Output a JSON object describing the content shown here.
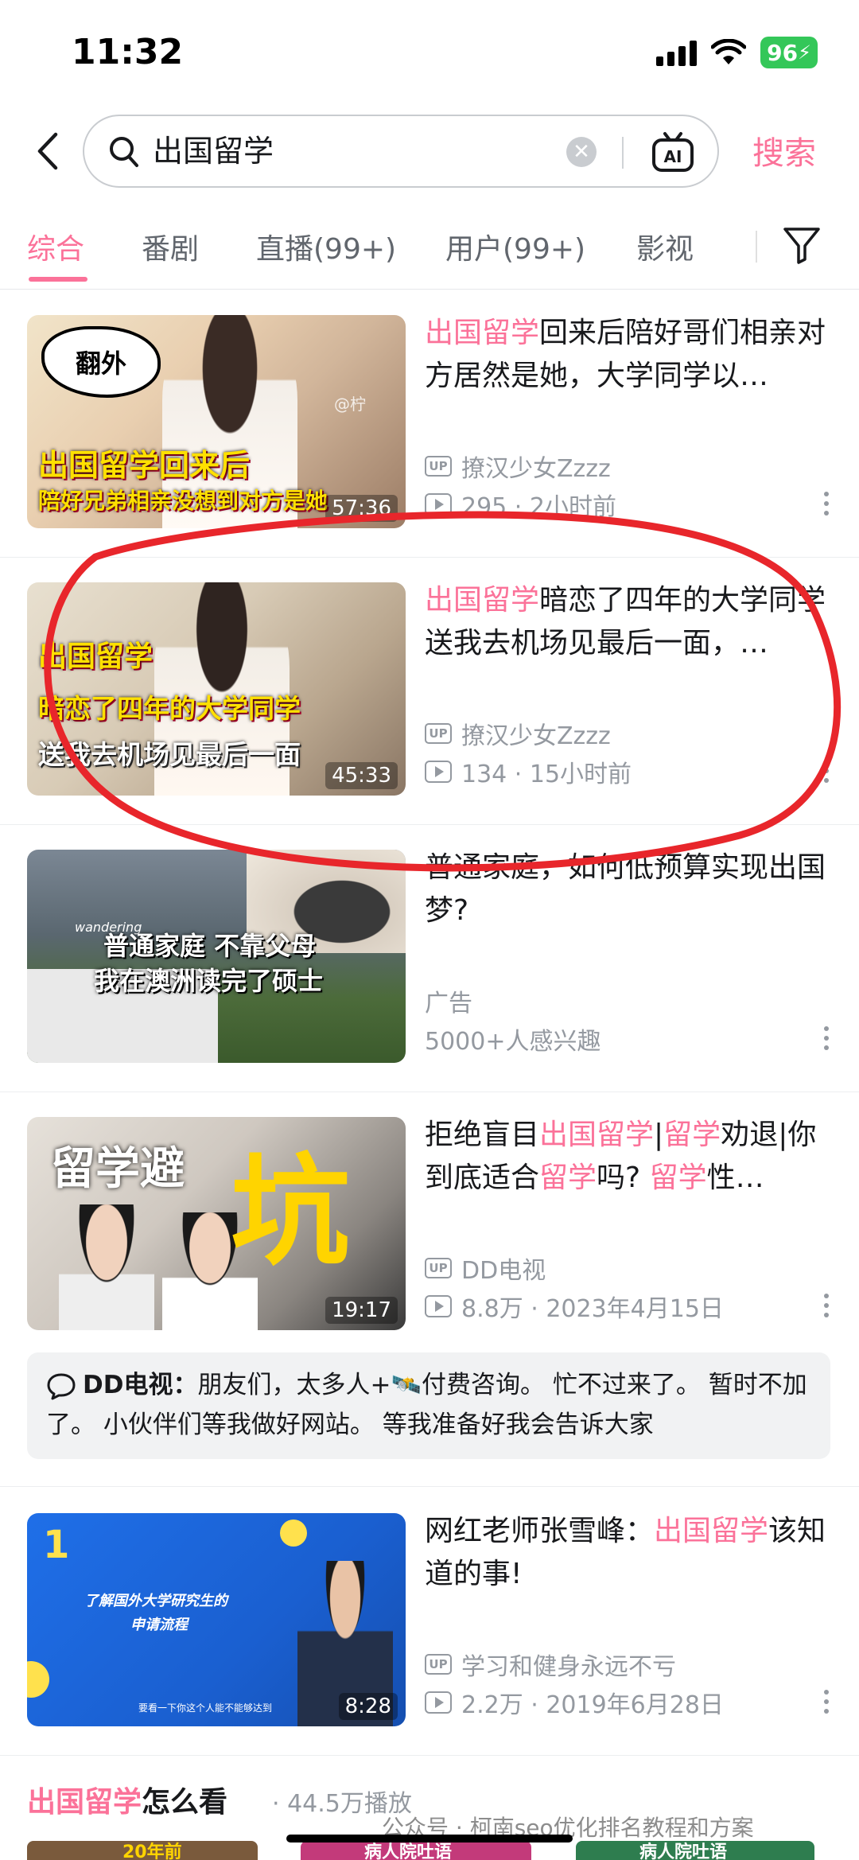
{
  "status_bar": {
    "time": "11:32",
    "battery": "96"
  },
  "search": {
    "query": "出国留学",
    "submit_label": "搜索"
  },
  "tabs": [
    {
      "label": "综合"
    },
    {
      "label": "番剧"
    },
    {
      "label": "直播(99+)"
    },
    {
      "label": "用户(99+)"
    },
    {
      "label": "影视"
    }
  ],
  "results": [
    {
      "title_hl": "出国留学",
      "title_rest": "回来后陪好哥们相亲对方居然是她，大学同学以…",
      "thumb_text_1": "翻外",
      "thumb_text_2": "出国留学回来后",
      "thumb_text_3": "陪好兄弟相亲没想到对方是她",
      "thumb_watermark": "@柠",
      "duration": "57:36",
      "uploader": "撩汉少女Zzzz",
      "views": "295 · 2小时前"
    },
    {
      "title_hl": "出国留学",
      "title_rest": "暗恋了四年的大学同学送我去机场见最后一面，…",
      "thumb_text_1": "出国留学",
      "thumb_text_2": "暗恋了四年的大学同学",
      "thumb_text_3": "送我去机场见最后一面",
      "duration": "45:33",
      "uploader": "撩汉少女Zzzz",
      "views": "134 · 15小时前"
    },
    {
      "title": "普通家庭，如何低预算实现出国梦?",
      "thumb_text_1": "普通家庭 不靠父母",
      "thumb_text_2": "我在澳洲读完了硕士",
      "thumb_small": "wandering",
      "ad_label": "广告",
      "interest": "5000+人感兴趣"
    },
    {
      "title_p1": "拒绝盲目",
      "title_hl1": "出国留学",
      "title_p2": "|",
      "title_hl2": "留学",
      "title_p3": "劝退|你到底适合",
      "title_hl3": "留学",
      "title_p4": "吗? ",
      "title_hl4": "留学",
      "title_p5": "性…",
      "thumb_text_1": "留学避",
      "thumb_text_2": "坑",
      "duration": "19:17",
      "uploader": "DD电视",
      "views": "8.8万 · 2023年4月15日"
    },
    {
      "title_p1": "网红老师张雪峰：",
      "title_hl": "出国留学",
      "title_p2": "该知道的事!",
      "thumb_number": "1",
      "thumb_text_1": "了解国外大学研究生的",
      "thumb_text_2": "申请流程",
      "thumb_caption": "要看一下你这个人能不能够达到",
      "duration": "8:28",
      "uploader": "学习和健身永远不亏",
      "views": "2.2万 · 2019年6月28日"
    }
  ],
  "comment": {
    "author": "DD电视：",
    "text": "朋友们，太多人+🛰️付费咨询。 忙不过来了。 暂时不加了。 小伙伴们等我做好网站。 等我准备好我会告诉大家"
  },
  "section": {
    "title_hl": "出国留学",
    "title_rest": "怎么看",
    "plays": "· 44.5万播放"
  },
  "watermark": "公众号 · 柯南seo优化排名教程和方案",
  "bottom_strip": {
    "label_1": "20年前",
    "label_2": "病人院吐语",
    "label_3": "病人院吐语"
  },
  "colors": {
    "accent": "#fb7299",
    "annotation": "#e8262b"
  }
}
